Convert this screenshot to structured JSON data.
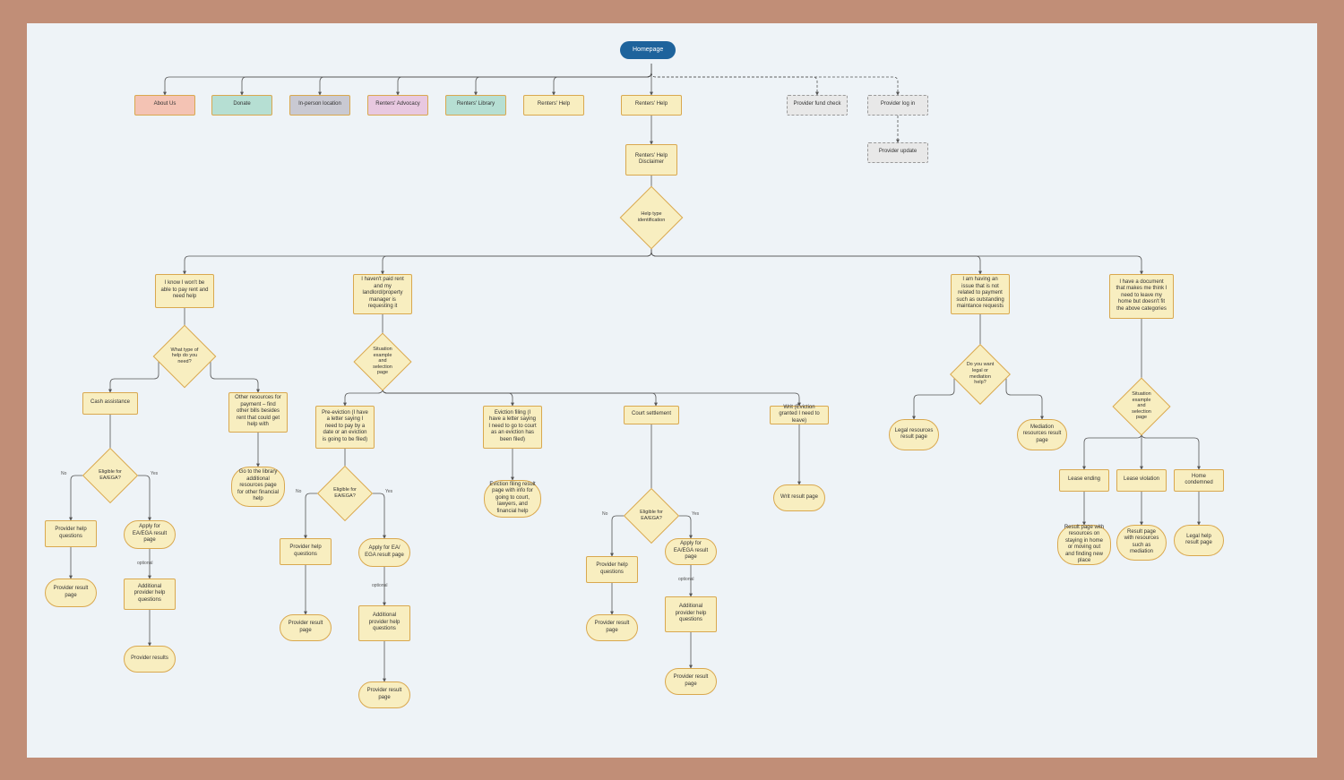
{
  "home": "Homepage",
  "nav": {
    "about": "About Us",
    "donate": "Donate",
    "loc": "In-person location",
    "adv": "Renters' Advocacy",
    "lib": "Renters' Library",
    "help": "Renters' Help"
  },
  "prov": {
    "fund": "Provider fund check",
    "login": "Provider log in",
    "update": "Provider update"
  },
  "disclaimer": "Renters' Help Disclaimer",
  "helpType": "Help type identification",
  "b1": {
    "start": "I know I won't be able to pay rent and need help",
    "q": "What type of help do you need?",
    "cash": "Cash assistance",
    "other": "Other resources for payment – find other bills besides rent that could get help with",
    "libPage": "Go to the library additional resources page for other financial help",
    "elig": "Eligible for EA/EGA?",
    "phq": "Provider help questions",
    "prp": "Provider result page",
    "apply": "Apply for EA/EGA result page",
    "addQ": "Additional provider help questions",
    "pr": "Provider results"
  },
  "b2": {
    "start": "I haven't paid rent and my landlord/property manager is requesting it",
    "sit": "Situation example and selection page",
    "pre": "Pre-eviction (I have a letter saying I need to pay by a date or an eviction is going to be filed)",
    "evf": "Eviction filing (I have a letter saying I need to go to court as an eviction has been filed)",
    "court": "Court settlement",
    "writ": "Writ (Eviction granted I need to leave)",
    "evfRes": "Eviction filing result page with info for going to court, lawyers, and financial help",
    "writRes": "Writ result page",
    "elig": "Eligible for EA/EGA?",
    "phq": "Provider help questions",
    "prp": "Provider result page",
    "apply": "Apply for EA/ EGA result page",
    "addQ": "Additional provider help questions",
    "prp2": "Provider result page",
    "elig2": "Eligible for EA/EGA?",
    "phq2": "Provider help questions",
    "prp3": "Provider result page",
    "apply2": "Apply for EA/EGA result page",
    "addQ2": "Additional provider help questions",
    "prp4": "Provider result page"
  },
  "b3": {
    "start": "I am having an issue that is not related to payment such as outstanding maintance requests",
    "q": "Do you want legal or mediation help?",
    "legal": "Legal resources result page",
    "med": "Mediation resources result page"
  },
  "b4": {
    "start": "I have a document that makes me think I need to leave my home but doesn't fit the above categories",
    "sit": "Situation example and selection page",
    "lease": "Lease ending",
    "viol": "Lease violation",
    "cond": "Home condemned",
    "r1": "Result page with resources on staying in home or moving out and finding new place",
    "r2": "Result page with resources such as mediation",
    "r3": "Legal help result page"
  },
  "labels": {
    "no": "No",
    "yes": "Yes",
    "opt": "optional"
  }
}
